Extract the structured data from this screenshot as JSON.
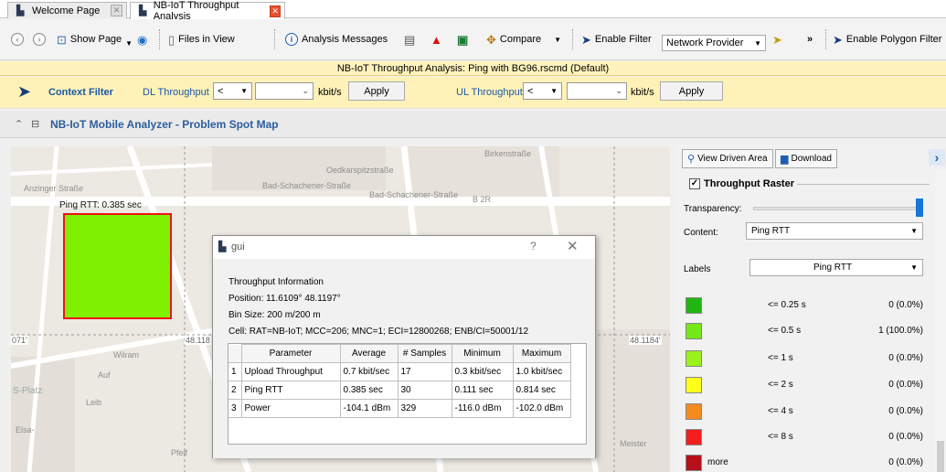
{
  "tabs": [
    {
      "label": "Welcome Page",
      "active": false
    },
    {
      "label": "NB-IoT Throughput Analysis",
      "active": true
    }
  ],
  "toolbar": {
    "show_page": "Show Page",
    "files_in_view": "Files in View",
    "analysis_messages": "Analysis Messages",
    "compare": "Compare",
    "enable_filter": "Enable Filter",
    "network_provider": "Network Provider",
    "overflow": "»",
    "enable_polygon_filter": "Enable Polygon Filter"
  },
  "title_strip": "NB-IoT Throughput Analysis:  Ping with BG96.rscmd (Default)",
  "context_filter": {
    "title": "Context Filter",
    "dl_label": "DL Throughput",
    "dl_operator": "<",
    "dl_value": "",
    "dl_unit": "kbit/s",
    "dl_apply": "Apply",
    "ul_label": "UL Throughput",
    "ul_operator": "<",
    "ul_value": "",
    "ul_unit": "kbit/s",
    "ul_apply": "Apply"
  },
  "panel": {
    "title": "NB-IoT Mobile Analyzer - Problem Spot Map"
  },
  "map": {
    "bin_label": "Ping RTT: 0.385 sec",
    "bin_color": "#7ff000",
    "coord_left": "071'",
    "coord_mid": "48.118",
    "coord_right": "48.1184'",
    "streets": [
      "Anzinger Straße",
      "Oedkarspitzstraße",
      "Bad-Schachener-Straße",
      "Bad-Schachener-Straße",
      "B 2R",
      "Birkenstraße",
      "S-Platz",
      "Leib",
      "Elsa-",
      "Pfeif",
      "Auf",
      "Wilram",
      "Meister"
    ]
  },
  "dialog": {
    "title": "gui",
    "help": "?",
    "close": "✕",
    "heading": "Throughput Information",
    "position": "Position: 11.6109° 48.1197°",
    "bin_size": "Bin Size: 200 m/200 m",
    "cell": "Cell: RAT=NB-IoT; MCC=206; MNC=1; ECI=12800268; ENB/CI=50001/12",
    "columns": [
      "Parameter",
      "Average",
      "# Samples",
      "Minimum",
      "Maximum"
    ],
    "rows": [
      [
        "1",
        "Upload Throughput",
        "0.7 kbit/sec",
        "17",
        "0.3 kbit/sec",
        "1.0 kbit/sec"
      ],
      [
        "2",
        "Ping RTT",
        "0.385 sec",
        "30",
        "0.111 sec",
        "0.814 sec"
      ],
      [
        "3",
        "Power",
        "-104.1 dBm",
        "329",
        "-116.0 dBm",
        "-102.0 dBm"
      ]
    ]
  },
  "right_panel": {
    "view_driven_area": "View Driven Area",
    "download": "Download",
    "raster_title": "Throughput Raster",
    "transparency_label": "Transparency:",
    "transparency_level": 1.0,
    "content_label": "Content:",
    "content_value": "Ping RTT",
    "labels_label": "Labels",
    "labels_value": "Ping RTT",
    "legend": [
      {
        "color": "#22b614",
        "label": "<= 0.25 s",
        "count": "0 (0.0%)"
      },
      {
        "color": "#74e818",
        "label": "<= 0.5 s",
        "count": "1 (100.0%)"
      },
      {
        "color": "#9cf01c",
        "label": "<= 1 s",
        "count": "0 (0.0%)"
      },
      {
        "color": "#ffff1a",
        "label": "<= 2 s",
        "count": "0 (0.0%)"
      },
      {
        "color": "#f58a1e",
        "label": "<= 4 s",
        "count": "0 (0.0%)"
      },
      {
        "color": "#f21d1d",
        "label": "<= 8 s",
        "count": "0 (0.0%)"
      },
      {
        "color": "#b8101a",
        "label": "more",
        "count": "0 (0.0%)"
      }
    ]
  }
}
